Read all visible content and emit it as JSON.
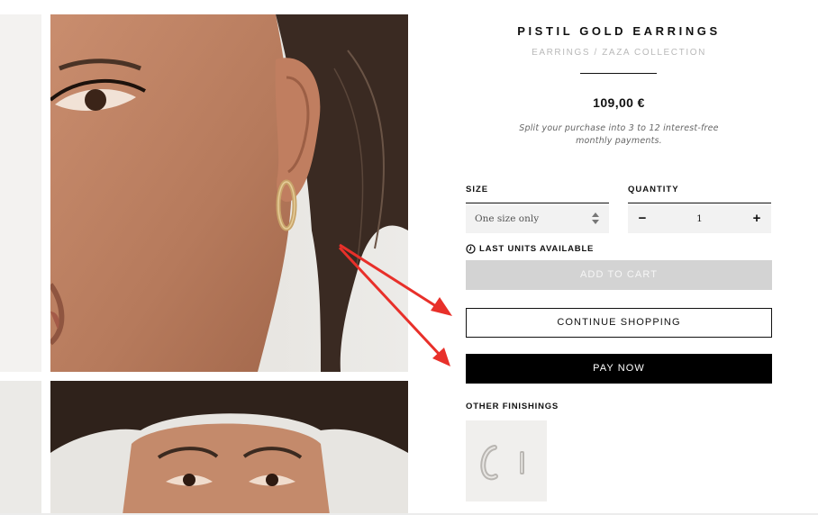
{
  "product": {
    "name": "PISTIL GOLD EARRINGS",
    "breadcrumb": "EARRINGS / ZAZA COLLECTION",
    "price": "109,00 €",
    "installments": "Split your purchase into 3 to 12 interest-free monthly payments."
  },
  "size": {
    "label": "SIZE",
    "selected": "One size only"
  },
  "quantity": {
    "label": "QUANTITY",
    "value": "1",
    "minus": "−",
    "plus": "+"
  },
  "stock_notice": "LAST UNITS AVAILABLE",
  "buttons": {
    "add_to_cart": "ADD TO CART",
    "continue_shopping": "CONTINUE SHOPPING",
    "pay_now": "PAY NOW"
  },
  "other_finishings": {
    "label": "OTHER FINISHINGS"
  },
  "colors": {
    "annotation_arrow": "#e8302a",
    "disabled_button": "#d3d3d3",
    "primary_button": "#000000"
  },
  "icons": {
    "stock": "clock-icon",
    "size_select": "select-arrows-icon"
  }
}
